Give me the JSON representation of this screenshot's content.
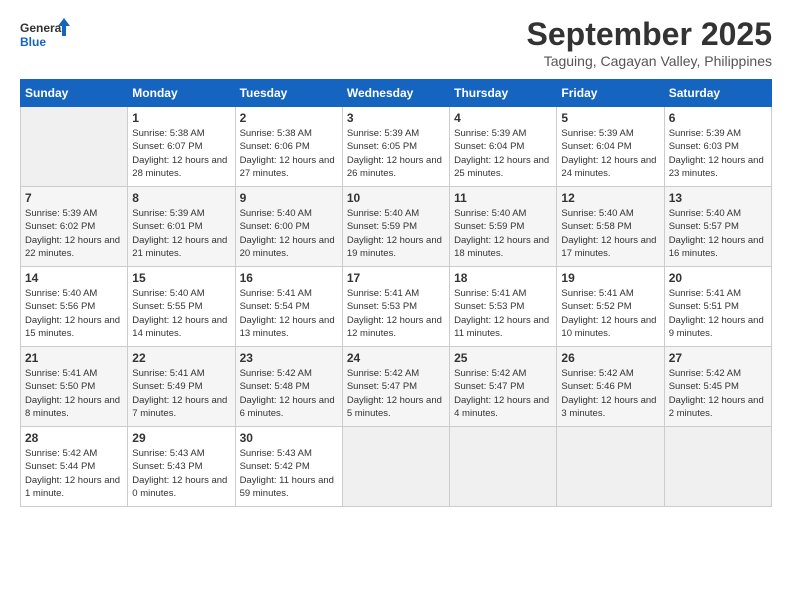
{
  "header": {
    "logo_general": "General",
    "logo_blue": "Blue",
    "month_title": "September 2025",
    "location": "Taguing, Cagayan Valley, Philippines"
  },
  "calendar": {
    "days_of_week": [
      "Sunday",
      "Monday",
      "Tuesday",
      "Wednesday",
      "Thursday",
      "Friday",
      "Saturday"
    ],
    "weeks": [
      [
        {
          "day": "",
          "info": ""
        },
        {
          "day": "1",
          "info": "Sunrise: 5:38 AM\nSunset: 6:07 PM\nDaylight: 12 hours\nand 28 minutes."
        },
        {
          "day": "2",
          "info": "Sunrise: 5:38 AM\nSunset: 6:06 PM\nDaylight: 12 hours\nand 27 minutes."
        },
        {
          "day": "3",
          "info": "Sunrise: 5:39 AM\nSunset: 6:05 PM\nDaylight: 12 hours\nand 26 minutes."
        },
        {
          "day": "4",
          "info": "Sunrise: 5:39 AM\nSunset: 6:04 PM\nDaylight: 12 hours\nand 25 minutes."
        },
        {
          "day": "5",
          "info": "Sunrise: 5:39 AM\nSunset: 6:04 PM\nDaylight: 12 hours\nand 24 minutes."
        },
        {
          "day": "6",
          "info": "Sunrise: 5:39 AM\nSunset: 6:03 PM\nDaylight: 12 hours\nand 23 minutes."
        }
      ],
      [
        {
          "day": "7",
          "info": "Sunrise: 5:39 AM\nSunset: 6:02 PM\nDaylight: 12 hours\nand 22 minutes."
        },
        {
          "day": "8",
          "info": "Sunrise: 5:39 AM\nSunset: 6:01 PM\nDaylight: 12 hours\nand 21 minutes."
        },
        {
          "day": "9",
          "info": "Sunrise: 5:40 AM\nSunset: 6:00 PM\nDaylight: 12 hours\nand 20 minutes."
        },
        {
          "day": "10",
          "info": "Sunrise: 5:40 AM\nSunset: 5:59 PM\nDaylight: 12 hours\nand 19 minutes."
        },
        {
          "day": "11",
          "info": "Sunrise: 5:40 AM\nSunset: 5:59 PM\nDaylight: 12 hours\nand 18 minutes."
        },
        {
          "day": "12",
          "info": "Sunrise: 5:40 AM\nSunset: 5:58 PM\nDaylight: 12 hours\nand 17 minutes."
        },
        {
          "day": "13",
          "info": "Sunrise: 5:40 AM\nSunset: 5:57 PM\nDaylight: 12 hours\nand 16 minutes."
        }
      ],
      [
        {
          "day": "14",
          "info": "Sunrise: 5:40 AM\nSunset: 5:56 PM\nDaylight: 12 hours\nand 15 minutes."
        },
        {
          "day": "15",
          "info": "Sunrise: 5:40 AM\nSunset: 5:55 PM\nDaylight: 12 hours\nand 14 minutes."
        },
        {
          "day": "16",
          "info": "Sunrise: 5:41 AM\nSunset: 5:54 PM\nDaylight: 12 hours\nand 13 minutes."
        },
        {
          "day": "17",
          "info": "Sunrise: 5:41 AM\nSunset: 5:53 PM\nDaylight: 12 hours\nand 12 minutes."
        },
        {
          "day": "18",
          "info": "Sunrise: 5:41 AM\nSunset: 5:53 PM\nDaylight: 12 hours\nand 11 minutes."
        },
        {
          "day": "19",
          "info": "Sunrise: 5:41 AM\nSunset: 5:52 PM\nDaylight: 12 hours\nand 10 minutes."
        },
        {
          "day": "20",
          "info": "Sunrise: 5:41 AM\nSunset: 5:51 PM\nDaylight: 12 hours\nand 9 minutes."
        }
      ],
      [
        {
          "day": "21",
          "info": "Sunrise: 5:41 AM\nSunset: 5:50 PM\nDaylight: 12 hours\nand 8 minutes."
        },
        {
          "day": "22",
          "info": "Sunrise: 5:41 AM\nSunset: 5:49 PM\nDaylight: 12 hours\nand 7 minutes."
        },
        {
          "day": "23",
          "info": "Sunrise: 5:42 AM\nSunset: 5:48 PM\nDaylight: 12 hours\nand 6 minutes."
        },
        {
          "day": "24",
          "info": "Sunrise: 5:42 AM\nSunset: 5:47 PM\nDaylight: 12 hours\nand 5 minutes."
        },
        {
          "day": "25",
          "info": "Sunrise: 5:42 AM\nSunset: 5:47 PM\nDaylight: 12 hours\nand 4 minutes."
        },
        {
          "day": "26",
          "info": "Sunrise: 5:42 AM\nSunset: 5:46 PM\nDaylight: 12 hours\nand 3 minutes."
        },
        {
          "day": "27",
          "info": "Sunrise: 5:42 AM\nSunset: 5:45 PM\nDaylight: 12 hours\nand 2 minutes."
        }
      ],
      [
        {
          "day": "28",
          "info": "Sunrise: 5:42 AM\nSunset: 5:44 PM\nDaylight: 12 hours\nand 1 minute."
        },
        {
          "day": "29",
          "info": "Sunrise: 5:43 AM\nSunset: 5:43 PM\nDaylight: 12 hours\nand 0 minutes."
        },
        {
          "day": "30",
          "info": "Sunrise: 5:43 AM\nSunset: 5:42 PM\nDaylight: 11 hours\nand 59 minutes."
        },
        {
          "day": "",
          "info": ""
        },
        {
          "day": "",
          "info": ""
        },
        {
          "day": "",
          "info": ""
        },
        {
          "day": "",
          "info": ""
        }
      ]
    ]
  }
}
